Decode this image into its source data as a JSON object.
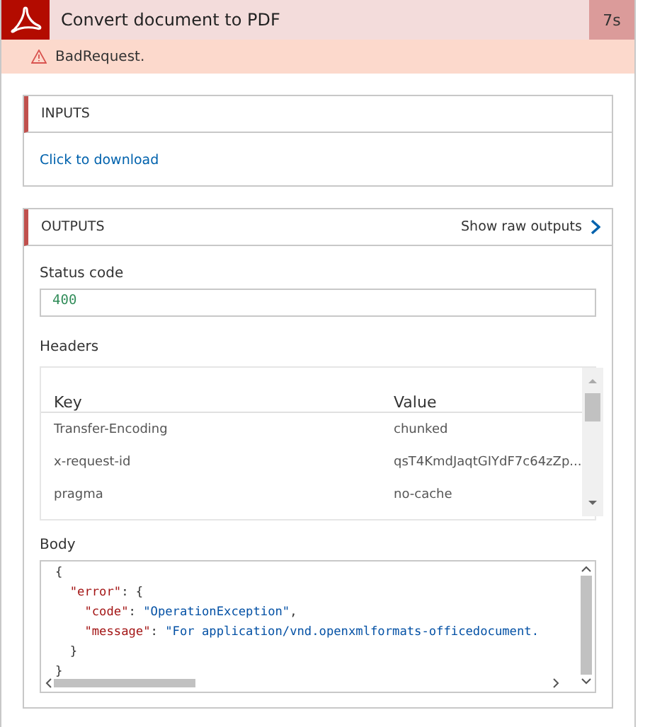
{
  "action": {
    "title": "Convert document to PDF",
    "duration": "7s",
    "status": "BadRequest."
  },
  "inputs": {
    "title": "INPUTS",
    "link": "Click to download"
  },
  "outputs": {
    "title": "OUTPUTS",
    "raw_link": "Show raw outputs",
    "status_code": {
      "label": "Status code",
      "value": "400"
    },
    "headers": {
      "label": "Headers",
      "columns": [
        "Key",
        "Value"
      ],
      "rows": [
        [
          "Transfer-Encoding",
          "chunked"
        ],
        [
          "x-request-id",
          "qsT4KmdJaqtGIYdF7c64zZp..."
        ],
        [
          "pragma",
          "no-cache"
        ]
      ]
    },
    "body": {
      "label": "Body",
      "lines": [
        [
          {
            "kind": "punct",
            "text": "{"
          }
        ],
        [
          {
            "kind": "key",
            "text": "  \"error\""
          },
          {
            "kind": "punct",
            "text": ": {"
          }
        ],
        [
          {
            "kind": "key",
            "text": "    \"code\""
          },
          {
            "kind": "punct",
            "text": ": "
          },
          {
            "kind": "string",
            "text": "\"OperationException\""
          },
          {
            "kind": "punct",
            "text": ","
          }
        ],
        [
          {
            "kind": "key",
            "text": "    \"message\""
          },
          {
            "kind": "punct",
            "text": ": "
          },
          {
            "kind": "string",
            "text": "\"For application/vnd.openxmlformats-officedocument."
          }
        ],
        [
          {
            "kind": "punct",
            "text": "  }"
          }
        ],
        [
          {
            "kind": "punct",
            "text": "}"
          }
        ]
      ]
    }
  }
}
